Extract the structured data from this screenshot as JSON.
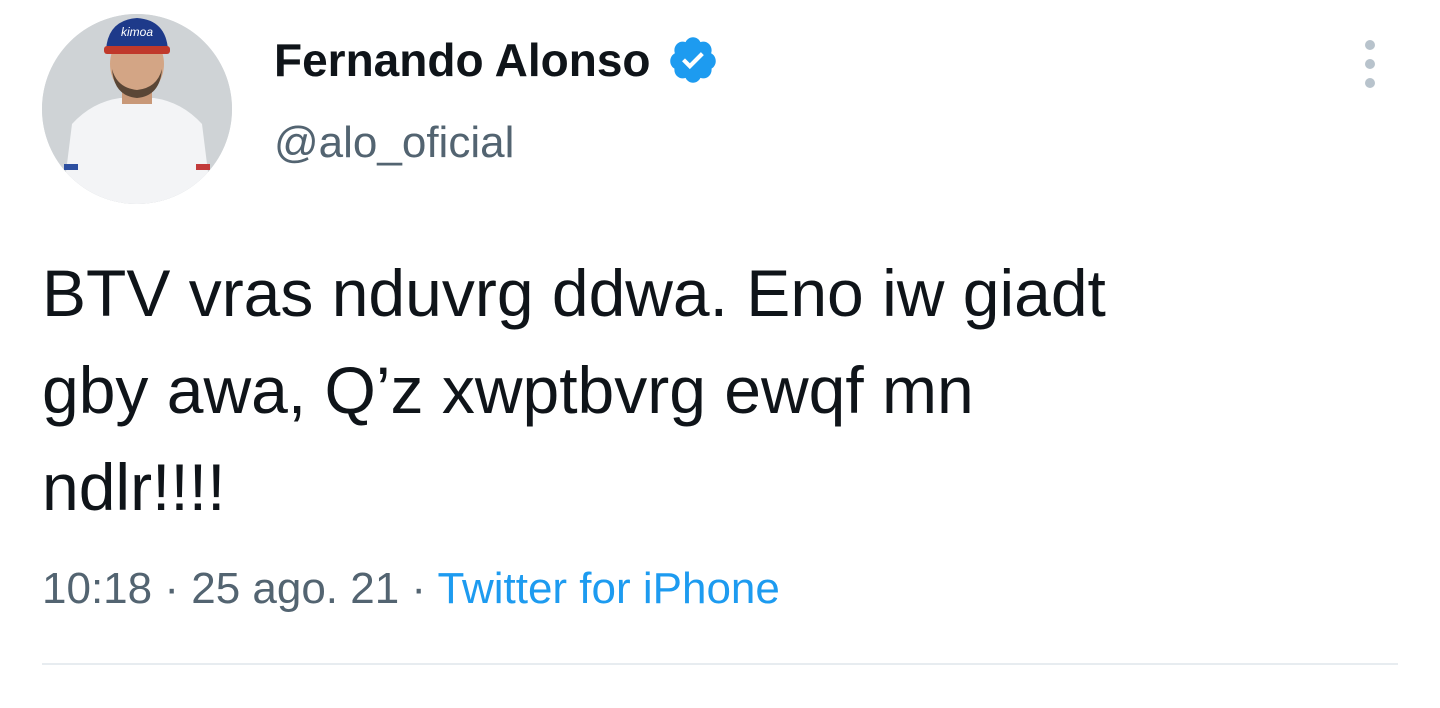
{
  "author": {
    "display_name": "Fernando Alonso",
    "handle": "@alo_oficial",
    "verified": true,
    "avatar_cap_text": "kimoa"
  },
  "icons": {
    "verified": "verified-badge-icon",
    "more": "more-options-icon"
  },
  "tweet": {
    "lines": [
      "BTV vras nduvrg ddwa. Eno iw giadt",
      "gby awa, Q’z xwptbvrg ewqf mn",
      "ndlr!!!!"
    ],
    "time": "10:18",
    "separator_1": " · ",
    "date": "25 ago. 21",
    "separator_2": " · ",
    "source": "Twitter for iPhone"
  },
  "colors": {
    "text": "#0f1419",
    "secondary": "#536471",
    "accent": "#1d9bf0",
    "divider": "#e7ecf0"
  }
}
